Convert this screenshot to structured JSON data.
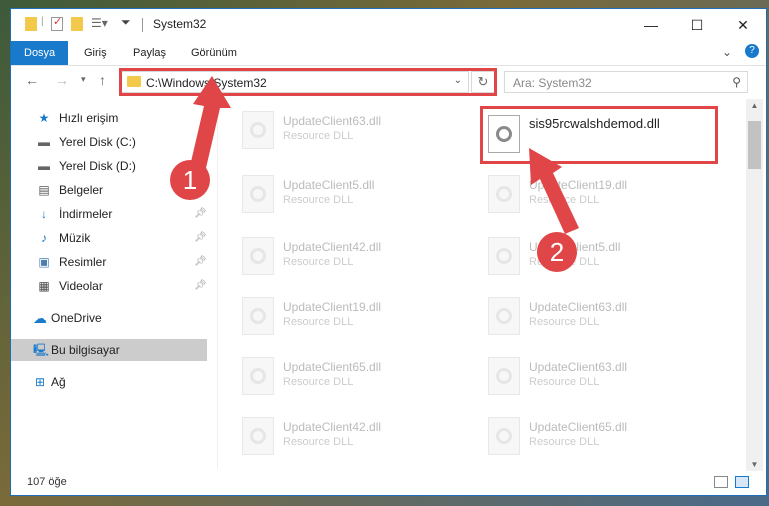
{
  "window": {
    "title": "System32"
  },
  "ribbon": {
    "tabs": [
      {
        "label": "Dosya",
        "active": true
      },
      {
        "label": "Giriş",
        "active": false
      },
      {
        "label": "Paylaş",
        "active": false
      },
      {
        "label": "Görünüm",
        "active": false
      }
    ]
  },
  "nav": {
    "address": "C:\\Windows\\System32",
    "search_placeholder": "Ara: System32"
  },
  "sidebar": {
    "items": [
      {
        "label": "Hızlı erişim",
        "icon": "star-icon",
        "pinned": false
      },
      {
        "label": "Yerel Disk (C:)",
        "icon": "drive-icon",
        "pinned": false
      },
      {
        "label": "Yerel Disk (D:)",
        "icon": "drive-icon",
        "pinned": false
      },
      {
        "label": "Belgeler",
        "icon": "document-icon",
        "pinned": false
      },
      {
        "label": "İndirmeler",
        "icon": "download-icon",
        "pinned": true
      },
      {
        "label": "Müzik",
        "icon": "music-icon",
        "pinned": true
      },
      {
        "label": "Resimler",
        "icon": "picture-icon",
        "pinned": true
      },
      {
        "label": "Videolar",
        "icon": "video-icon",
        "pinned": true
      },
      {
        "label": "OneDrive",
        "icon": "cloud-icon",
        "pinned": false
      },
      {
        "label": "Bu bilgisayar",
        "icon": "computer-icon",
        "pinned": false,
        "selected": true
      },
      {
        "label": "Ağ",
        "icon": "network-icon",
        "pinned": false
      }
    ]
  },
  "files": {
    "left": [
      {
        "name": "UpdateClient63.dll",
        "type": "Resource DLL"
      },
      {
        "name": "UpdateClient5.dll",
        "type": "Resource DLL"
      },
      {
        "name": "UpdateClient42.dll",
        "type": "Resource DLL"
      },
      {
        "name": "UpdateClient19.dll",
        "type": "Resource DLL"
      },
      {
        "name": "UpdateClient65.dll",
        "type": "Resource DLL"
      },
      {
        "name": "UpdateClient42.dll",
        "type": "Resource DLL"
      }
    ],
    "right": [
      {
        "name": "sis95rcwalshdemod.dll",
        "type": ""
      },
      {
        "name": "UpdateClient19.dll",
        "type": "Resource DLL"
      },
      {
        "name": "UpdateClient5.dll",
        "type": "Resource DLL"
      },
      {
        "name": "UpdateClient63.dll",
        "type": "Resource DLL"
      },
      {
        "name": "UpdateClient63.dll",
        "type": "Resource DLL"
      },
      {
        "name": "UpdateClient65.dll",
        "type": "Resource DLL"
      }
    ]
  },
  "status": {
    "count": "107 öğe"
  },
  "annotations": {
    "step1": "1",
    "step2": "2",
    "color": "#e04548"
  }
}
